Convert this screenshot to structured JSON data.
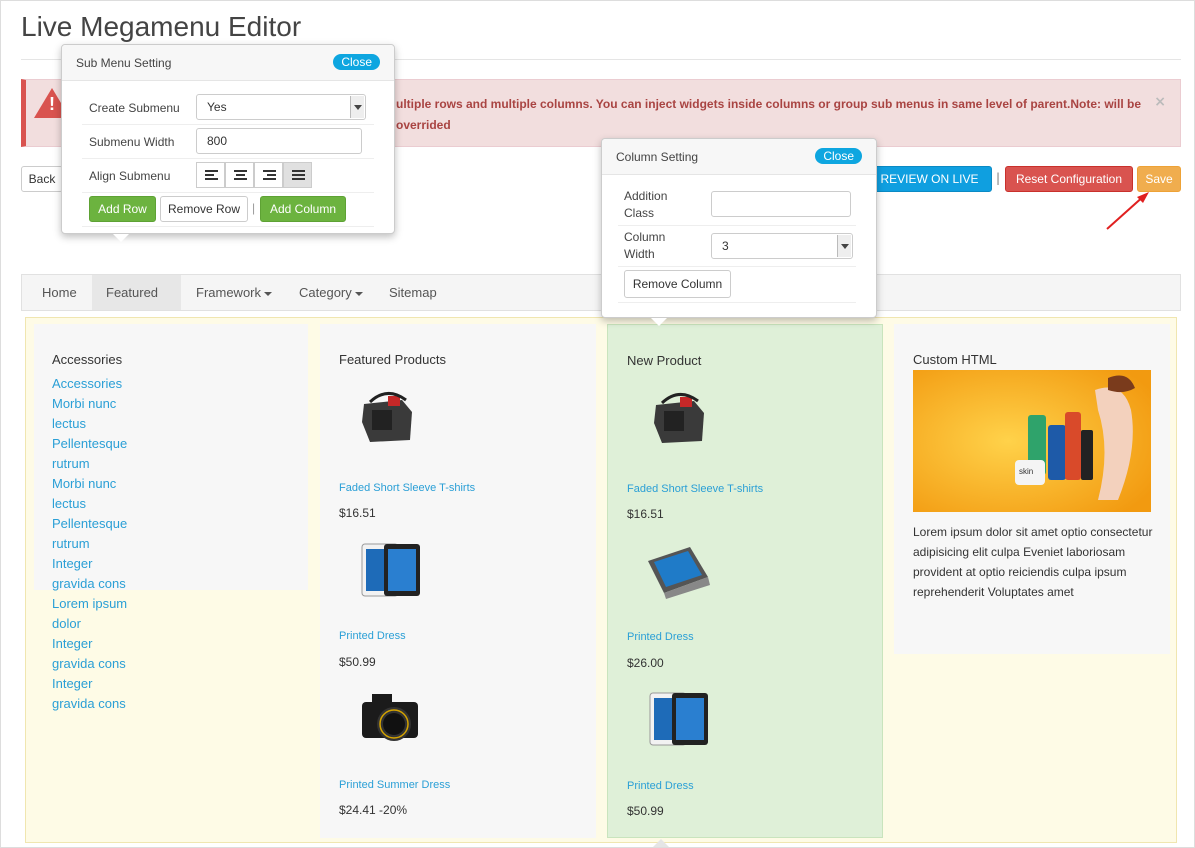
{
  "page": {
    "title": "Live Megamenu Editor"
  },
  "alert": {
    "icon": "warning-icon",
    "text": "ultiple rows and multiple columns. You can inject widgets inside columns or group sub menus in same level of parent.Note: will be overrided",
    "close": "×"
  },
  "toolbar": {
    "back_label": "Back",
    "preview_label": "REVIEW ON LIVE SITE",
    "separator": "|",
    "reset_label": "Reset Configuration",
    "save_label": "Save"
  },
  "nav": {
    "items": [
      {
        "label": "Home"
      },
      {
        "label": "Featured"
      },
      {
        "label": "Framework"
      },
      {
        "label": "Category"
      },
      {
        "label": "Sitemap"
      }
    ]
  },
  "columns": {
    "accessories": {
      "heading": "Accessories",
      "links": [
        "Accessories",
        "Morbi nunc lectus",
        "Pellentesque rutrum",
        "Morbi nunc lectus",
        "Pellentesque rutrum",
        "Integer gravida cons",
        "Lorem ipsum dolor",
        "Integer gravida cons",
        "Integer gravida cons"
      ]
    },
    "featured": {
      "heading": "Featured Products",
      "products": [
        {
          "name": "Faded Short Sleeve T-shirts",
          "price": "$16.51",
          "image": "camera-bag-image"
        },
        {
          "name": "Printed Dress",
          "price": "$50.99",
          "image": "tablet-image"
        },
        {
          "name": "Printed Summer Dress",
          "price": "$24.41 -20%",
          "image": "dslr-camera-image"
        }
      ]
    },
    "new_product": {
      "heading": "New Product",
      "products": [
        {
          "name": "Faded Short Sleeve T-shirts",
          "price": "$16.51",
          "image": "camera-bag-image"
        },
        {
          "name": "Printed Dress",
          "price": "$26.00",
          "image": "tablet-keyboard-image"
        },
        {
          "name": "Printed Dress",
          "price": "$50.99",
          "image": "tablet-image"
        }
      ]
    },
    "custom_html": {
      "heading": "Custom HTML",
      "image_label": "skin",
      "text": "Lorem ipsum dolor sit amet optio consectetur adipisicing elit culpa Eveniet laboriosam provident at optio reiciendis culpa ipsum reprehenderit Voluptates amet"
    }
  },
  "submenu_popup": {
    "title": "Sub Menu Setting",
    "close_label": "Close",
    "create_label": "Create Submenu",
    "create_value": "Yes",
    "width_label": "Submenu Width",
    "width_value": "800",
    "align_label": "Align Submenu",
    "add_row": "Add Row",
    "remove_row": "Remove Row",
    "separator": "|",
    "add_column": "Add Column"
  },
  "column_popup": {
    "title": "Column Setting",
    "close_label": "Close",
    "class_label": "Addition Class",
    "class_value": "",
    "width_label": "Column Width",
    "width_value": "3",
    "remove_column": "Remove Column"
  },
  "colors": {
    "accent_blue": "#0ea6e0",
    "danger": "#d9534f",
    "warning": "#f0ad4e",
    "success": "#6cb33f",
    "link": "#2a9fd6"
  }
}
